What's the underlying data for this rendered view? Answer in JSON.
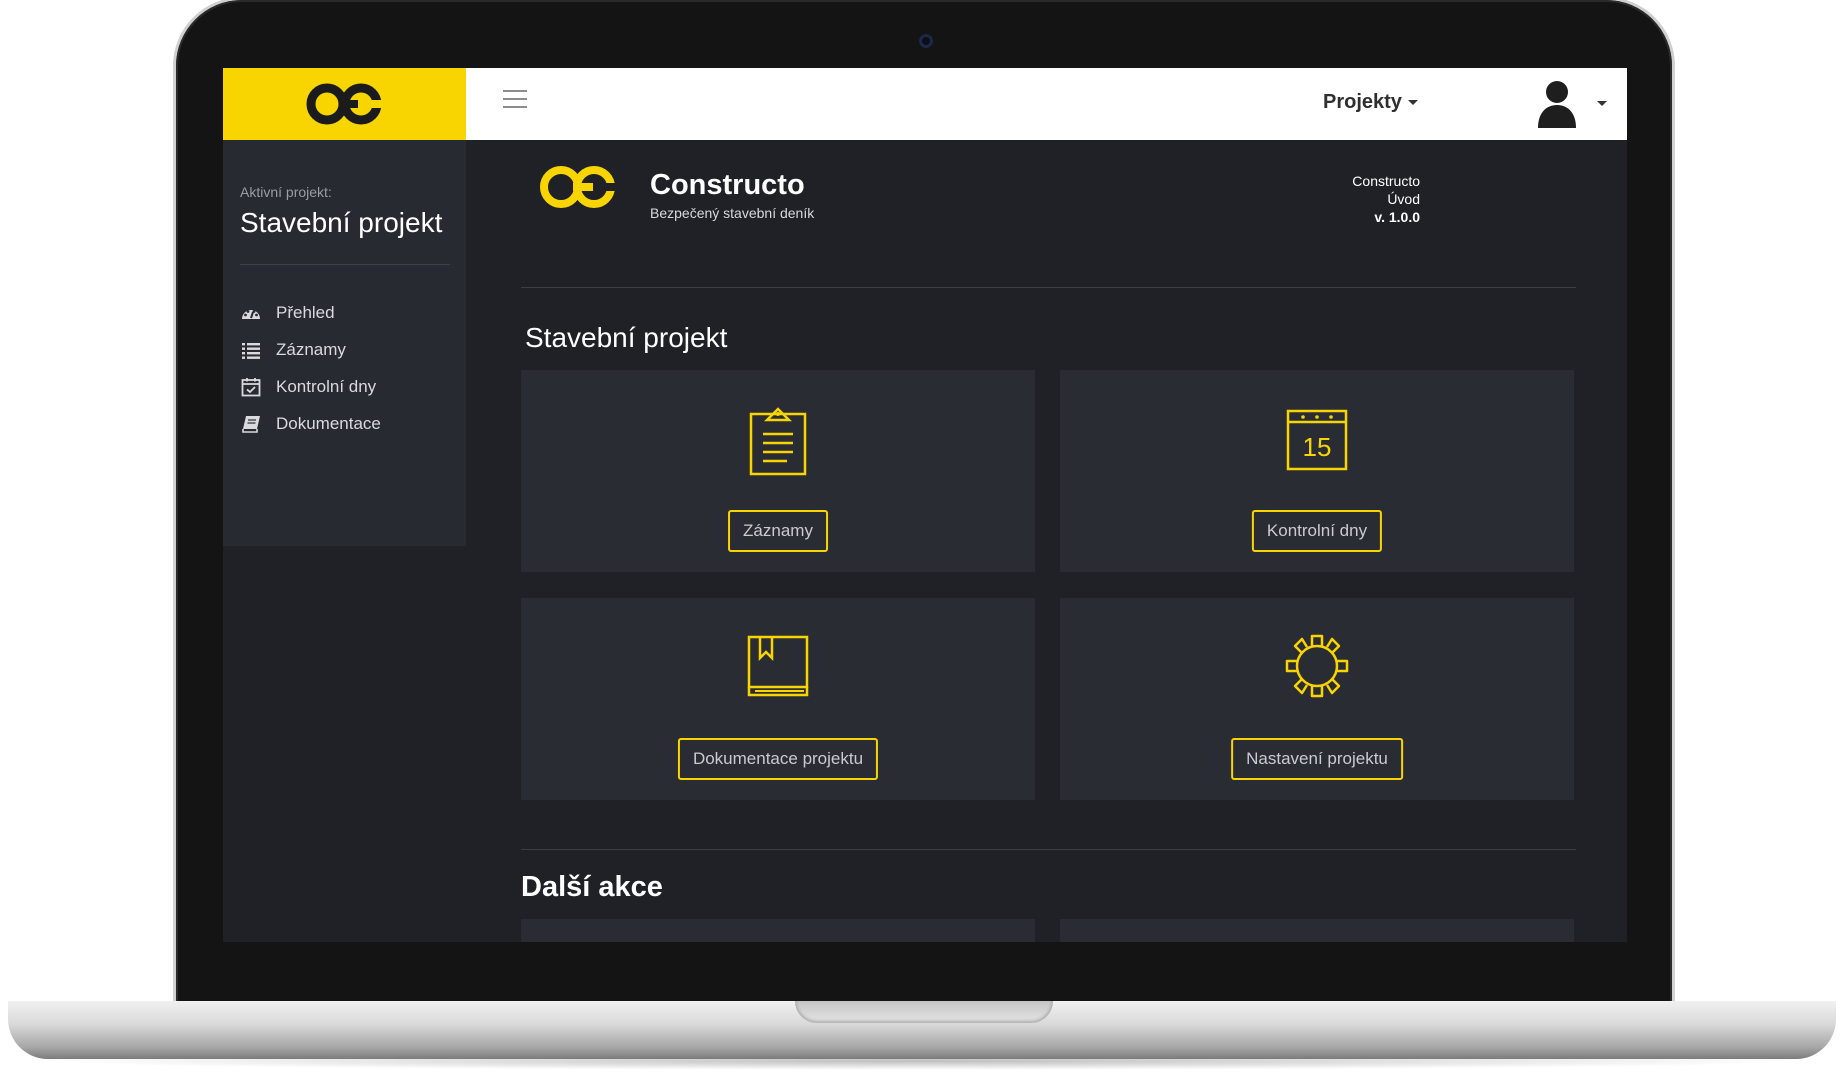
{
  "topbar": {
    "projects_menu_label": "Projekty"
  },
  "sidebar": {
    "active_label": "Aktivní projekt:",
    "project_name": "Stavební projekt",
    "items": [
      {
        "label": "Přehled",
        "icon": "dashboard-icon"
      },
      {
        "label": "Záznamy",
        "icon": "list-icon"
      },
      {
        "label": "Kontrolní dny",
        "icon": "calendar-check-icon"
      },
      {
        "label": "Dokumentace",
        "icon": "book-icon"
      }
    ]
  },
  "header": {
    "brand_title": "Constructo",
    "brand_subtitle": "Bezpečený stavební deník",
    "meta": [
      "Constructo",
      "Úvod",
      "v. 1.0.0"
    ]
  },
  "main": {
    "section_title": "Stavební projekt",
    "cards": [
      {
        "label": "Záznamy",
        "icon": "clipboard-icon"
      },
      {
        "label": "Kontrolní dny",
        "icon": "calendar-icon",
        "icon_text": "15"
      },
      {
        "label": "Dokumentace projektu",
        "icon": "book-icon"
      },
      {
        "label": "Nastavení projektu",
        "icon": "gear-icon"
      }
    ],
    "more_title": "Další akce"
  },
  "colors": {
    "accent": "#f9d500",
    "background": "#1f2127",
    "panel": "#2a2c34",
    "sidebar": "#272a31"
  }
}
